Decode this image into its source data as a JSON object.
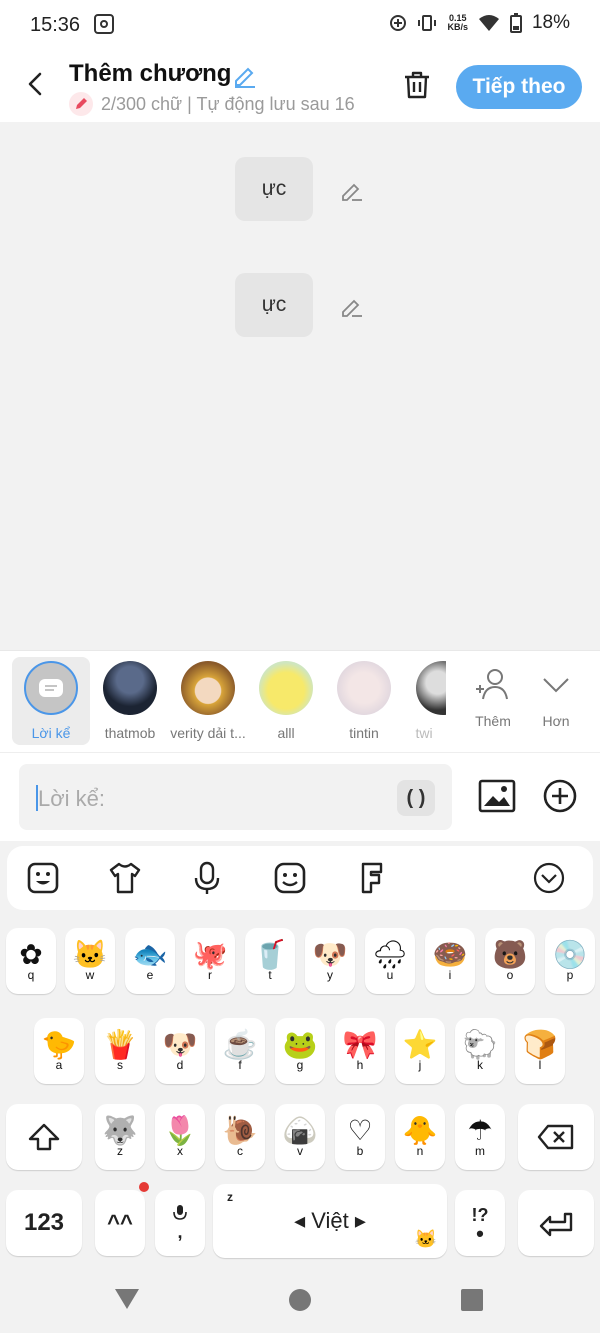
{
  "status": {
    "time": "15:36",
    "net_speed": "0.15",
    "net_unit": "KB/s",
    "battery": "18%"
  },
  "header": {
    "title": "Thêm chương",
    "subtitle": "2/300 chữ | Tự động lưu sau 16",
    "next_label": "Tiếp theo"
  },
  "messages": [
    {
      "text": "ực"
    },
    {
      "text": "ực"
    }
  ],
  "characters": [
    {
      "label": "Lời kể",
      "selected": true
    },
    {
      "label": "thatmob"
    },
    {
      "label": "verity dải t..."
    },
    {
      "label": "alll"
    },
    {
      "label": "tintin"
    },
    {
      "label": "twi"
    }
  ],
  "char_actions": {
    "add_label": "Thêm",
    "more_label": "Hơn"
  },
  "input": {
    "placeholder": "Lời kể:",
    "paren_label": "( )"
  },
  "keyboard": {
    "row1": [
      "q",
      "w",
      "e",
      "r",
      "t",
      "y",
      "u",
      "i",
      "o",
      "p"
    ],
    "row2": [
      "a",
      "s",
      "d",
      "f",
      "g",
      "h",
      "j",
      "k",
      "l"
    ],
    "row3": [
      "z",
      "x",
      "c",
      "v",
      "b",
      "n",
      "m"
    ],
    "num_label": "123",
    "emoticon_label": "^^",
    "space_label": "Việt",
    "punct_label": "!?",
    "comma_label": ","
  },
  "colors": {
    "accent": "#5aaaf0",
    "selected_text": "#4a96e8"
  }
}
